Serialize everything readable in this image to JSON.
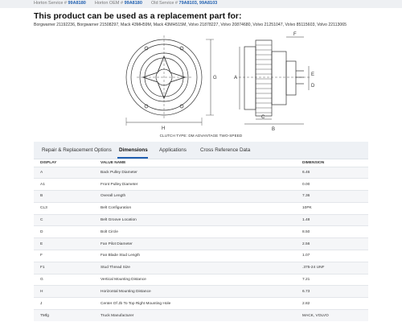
{
  "service": {
    "horton_service_label": "Horton Service #",
    "horton_service_value": "99A8180",
    "horton_oem_label": "Horton OEM #",
    "horton_oem_value": "99A8180",
    "old_service_label": "Old Service #",
    "old_service_value": "79A8103, 99A8103"
  },
  "headline": "This product can be used as a replacement part for:",
  "compatible_parts": "Borgwarner 21192236, Borgwarner 21508297, Mack 43MH59M, Mack 43MH515M, Volvo 21878227, Volvo 20874680, Volvo 21251047, Volvo 85115603, Volvo 22113065",
  "drawing": {
    "caption": "CLUTCH TYPE: DM ADVANTAGE TWO-SPEED",
    "labels": {
      "h": "H",
      "g": "G",
      "a": "A",
      "b": "B",
      "c": "C",
      "f": "F",
      "e": "E",
      "d": "D"
    }
  },
  "tabs": [
    {
      "label": "Repair & Replacement Options",
      "active": false
    },
    {
      "label": "Dimensions",
      "active": true
    },
    {
      "label": "Applications",
      "active": false
    },
    {
      "label": "Cross Reference Data",
      "active": false
    }
  ],
  "table": {
    "headers": [
      "DISPLAY",
      "VALUE NAME",
      "DIMENSION"
    ],
    "rows": [
      [
        "A",
        "Back Pulley Diameter",
        "6.46"
      ],
      [
        "A1",
        "Front Pulley Diameter",
        "0.00"
      ],
      [
        "B",
        "Overall Length",
        "7.36"
      ],
      [
        "CL3",
        "Belt Configuration",
        "10PK"
      ],
      [
        "C",
        "Belt Groove Location",
        "1.48"
      ],
      [
        "D",
        "Bolt Circle",
        "8.50"
      ],
      [
        "E",
        "Fan Pilot Diameter",
        "2.56"
      ],
      [
        "F",
        "Fan Blade Stud Length",
        "1.07"
      ],
      [
        "F1",
        "Stud Thread Size",
        ".375-24 UNF"
      ],
      [
        "G",
        "Vertical Mounting Distance",
        "7.21"
      ],
      [
        "H",
        "Horizontal Mounting Distance",
        "6.73"
      ],
      [
        "J",
        "Center Of Jb To Top Right Mounting Hole",
        "2.82"
      ],
      [
        "TMfg",
        "Truck Manufacturer",
        "MACK, VOLVO"
      ]
    ]
  },
  "colors": {
    "accent": "#1f5fb0",
    "tab_bg": "#eef1f5",
    "top_bar": "#eef0f3"
  }
}
